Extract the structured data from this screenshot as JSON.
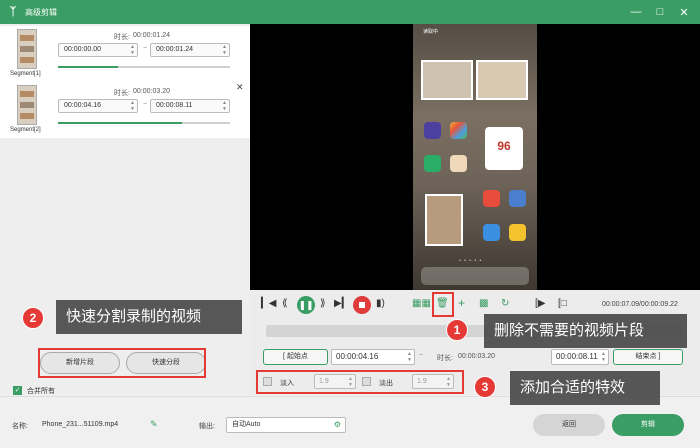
{
  "window": {
    "title": "高级剪辑",
    "logo_icon": "rabbit-logo-icon",
    "controls": [
      "minimize-icon",
      "maximize-icon",
      "close-icon"
    ],
    "accent": "#3a9d64"
  },
  "segments": [
    {
      "label": "Segment[1]",
      "duration_label": "时长:",
      "duration": "00:00:01.24",
      "start": "00:00:00.00",
      "end": "00:00:01.24",
      "separator": "~",
      "progress": 0.35
    },
    {
      "label": "Segment[2]",
      "duration_label": "时长:",
      "duration": "00:00:03.20",
      "start": "00:00:04.16",
      "end": "00:00:08.11",
      "separator": "~",
      "progress": 0.72
    }
  ],
  "left_actions": {
    "new_segment": "新增片段",
    "quick_split": "快速分段",
    "merge_all": "合并所有",
    "merge_all_checked": true
  },
  "preview": {
    "status_text": "读取中",
    "calendar_number": "96"
  },
  "playback": {
    "time": "00:00:07.09/00:00:09.22",
    "icons": [
      "prev-frame-icon",
      "rewind-icon",
      "play-pause-icon",
      "forward-icon",
      "next-frame-icon",
      "record-icon",
      "volume-icon",
      "split-icon",
      "delete-icon",
      "add-icon",
      "copy-icon",
      "reset-icon",
      "mark-in-icon",
      "mark-out-icon"
    ]
  },
  "range": {
    "start_button": "起始点",
    "start_value": "00:00:04.16",
    "separator": "~",
    "duration_label": "时长:",
    "duration_value": "00:00:03.20",
    "end_value": "00:00:08.11",
    "end_button": "结束点"
  },
  "effects": {
    "fade_in_label": "淡入",
    "fade_in_value": "1.9",
    "fade_out_label": "淡出",
    "fade_out_value": "1.9"
  },
  "footer": {
    "name_label": "名称:",
    "name_value": "Phone_231...51109.mp4",
    "output_label": "输出:",
    "output_value": "自动Auto",
    "back_button": "返回",
    "cut_button": "剪辑"
  },
  "annotations": [
    {
      "number": "1",
      "text": "删除不需要的视频片段"
    },
    {
      "number": "2",
      "text": "快速分割录制的视频"
    },
    {
      "number": "3",
      "text": "添加合适的特效"
    }
  ]
}
